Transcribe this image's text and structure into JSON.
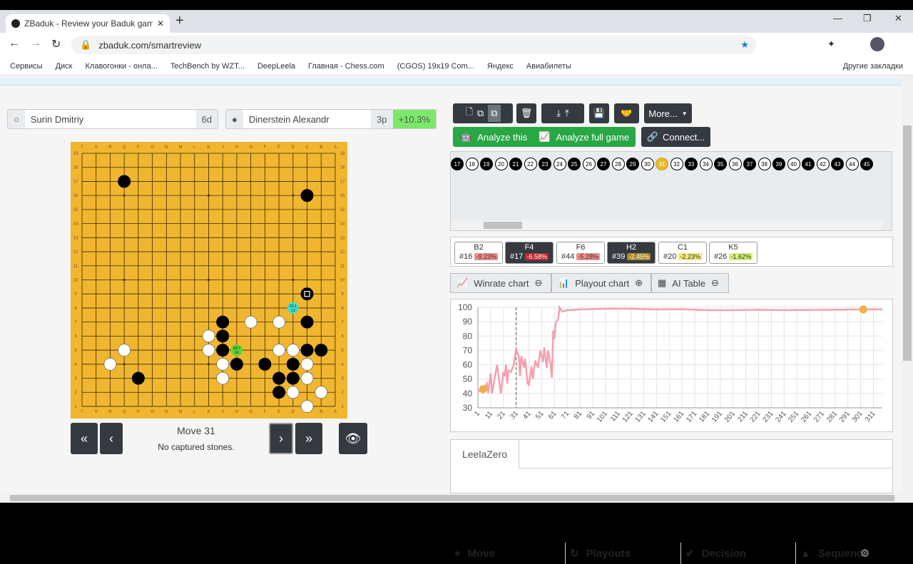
{
  "browser": {
    "tab_title": "ZBaduk - Review your Baduk gam",
    "new_tab": "+",
    "url": "zbaduk.com/smartreview",
    "bookmarks": [
      "Сервисы",
      "Диск",
      "Клавогонки - онла...",
      "TechBench by WZT...",
      "DeepLeela",
      "Главная - Chess.com",
      "(CGOS) 19x19 Com...",
      "Яндекс",
      "Авиабилеты"
    ],
    "other_bookmarks": "Другие закладки"
  },
  "players": {
    "white": {
      "name": "Surin Dmitriy",
      "rank": "6d"
    },
    "black": {
      "name": "Dinerstein Alexandr",
      "rank": "3p",
      "score": "+10.3%"
    }
  },
  "board": {
    "columns": [
      "T",
      "S",
      "R",
      "Q",
      "P",
      "O",
      "N",
      "M",
      "L",
      "K",
      "J",
      "H",
      "G",
      "F",
      "E",
      "D",
      "C",
      "B",
      "A"
    ],
    "black": [
      "Q17",
      "C16",
      "C9",
      "J7",
      "C7",
      "J6",
      "J5",
      "C5",
      "B5",
      "H4",
      "F4",
      "D4",
      "P3",
      "E3",
      "D3",
      "E2"
    ],
    "white": [
      "G7",
      "E7",
      "K6",
      "Q5",
      "K5",
      "E5",
      "D5",
      "R4",
      "J4",
      "C4",
      "J3",
      "C3",
      "D2",
      "B2",
      "C1"
    ],
    "last_move": "C9",
    "candidates": [
      {
        "point": "D8",
        "winrate": "29.1",
        "playouts": "13",
        "color": "#3ee0c8"
      },
      {
        "point": "H5",
        "winrate": "28.7",
        "playouts": "16",
        "color": "#5fd33a"
      }
    ]
  },
  "nav": {
    "move_label": "Move 31",
    "captures": "No captured stones.",
    "first": "«",
    "prev": "‹",
    "next": "›",
    "last": "»"
  },
  "toolbar": {
    "more": "More...",
    "analyze_this": "Analyze this",
    "analyze_full": "Analyze full game",
    "connect": "Connect..."
  },
  "moves": {
    "list": [
      [
        17,
        "b"
      ],
      [
        18,
        "w"
      ],
      [
        19,
        "b"
      ],
      [
        20,
        "w"
      ],
      [
        21,
        "b"
      ],
      [
        22,
        "w"
      ],
      [
        23,
        "b"
      ],
      [
        24,
        "w"
      ],
      [
        25,
        "b"
      ],
      [
        26,
        "w"
      ],
      [
        27,
        "b"
      ],
      [
        28,
        "w"
      ],
      [
        29,
        "b"
      ],
      [
        30,
        "w"
      ],
      [
        31,
        "cur"
      ],
      [
        32,
        "w"
      ],
      [
        33,
        "b"
      ],
      [
        34,
        "w"
      ],
      [
        35,
        "b"
      ],
      [
        36,
        "w"
      ],
      [
        37,
        "b"
      ],
      [
        38,
        "w"
      ],
      [
        39,
        "b"
      ],
      [
        40,
        "w"
      ],
      [
        41,
        "b"
      ],
      [
        42,
        "w"
      ],
      [
        43,
        "b"
      ],
      [
        44,
        "w"
      ],
      [
        45,
        "b"
      ]
    ]
  },
  "mistakes": [
    {
      "point": "B2",
      "move": "#16",
      "pct": "-9.23%",
      "color": "#f28b8b",
      "dark": false
    },
    {
      "point": "F4",
      "move": "#17",
      "pct": "-6.58%",
      "color": "#c0282e",
      "dark": true
    },
    {
      "point": "F6",
      "move": "#44",
      "pct": "-5.28%",
      "color": "#f28b8b",
      "dark": false
    },
    {
      "point": "H2",
      "move": "#39",
      "pct": "-2.45%",
      "color": "#a8882a",
      "dark": true
    },
    {
      "point": "C1",
      "move": "#20",
      "pct": "-2.23%",
      "color": "#f3ea7a",
      "dark": false
    },
    {
      "point": "K5",
      "move": "#26",
      "pct": "-1.62%",
      "color": "#d4f27a",
      "dark": false
    }
  ],
  "chart_tabs": [
    "Winrate chart",
    "Playout chart",
    "AI Table"
  ],
  "chart_data": {
    "type": "line",
    "ylim": [
      30,
      100
    ],
    "xlim": [
      1,
      318
    ],
    "yticks": [
      30,
      40,
      50,
      60,
      70,
      80,
      90,
      100
    ],
    "xticks": [
      1,
      11,
      21,
      31,
      41,
      51,
      61,
      71,
      81,
      91,
      101,
      111,
      121,
      131,
      141,
      151,
      161,
      171,
      181,
      191,
      201,
      211,
      221,
      231,
      241,
      251,
      261,
      271,
      281,
      291,
      301,
      311
    ],
    "current_move": 31,
    "line_color": "#f4a0b0",
    "marker_color": "#f0b040",
    "markers": [
      [
        5,
        43
      ],
      [
        303,
        98.5
      ]
    ],
    "series": [
      {
        "values": [
          [
            1,
            41
          ],
          [
            3,
            43
          ],
          [
            6,
            44
          ],
          [
            8,
            47
          ],
          [
            9,
            40
          ],
          [
            11,
            54
          ],
          [
            12,
            40
          ],
          [
            14,
            50
          ],
          [
            16,
            60
          ],
          [
            18,
            47
          ],
          [
            19,
            40
          ],
          [
            21,
            55
          ],
          [
            22,
            52
          ],
          [
            23,
            60
          ],
          [
            24,
            47
          ],
          [
            25,
            56
          ],
          [
            27,
            55
          ],
          [
            29,
            60
          ],
          [
            31,
            71
          ],
          [
            33,
            66
          ],
          [
            34,
            52
          ],
          [
            35,
            66
          ],
          [
            37,
            58
          ],
          [
            38,
            64
          ],
          [
            40,
            47
          ],
          [
            41,
            46
          ],
          [
            43,
            59
          ],
          [
            44,
            50
          ],
          [
            46,
            63
          ],
          [
            48,
            58
          ],
          [
            50,
            70
          ],
          [
            52,
            62
          ],
          [
            53,
            72
          ],
          [
            55,
            58
          ],
          [
            56,
            70
          ],
          [
            58,
            60
          ],
          [
            59,
            51
          ],
          [
            60,
            84
          ],
          [
            61,
            78
          ],
          [
            62,
            89
          ],
          [
            64,
            92
          ],
          [
            65,
            100
          ],
          [
            67,
            97
          ],
          [
            71,
            98
          ],
          [
            81,
            98.5
          ],
          [
            101,
            99
          ],
          [
            121,
            99
          ],
          [
            141,
            98.5
          ],
          [
            161,
            98.7
          ],
          [
            181,
            98
          ],
          [
            201,
            98
          ],
          [
            221,
            98.3
          ],
          [
            241,
            98
          ],
          [
            261,
            98.2
          ],
          [
            281,
            98.3
          ],
          [
            301,
            98.5
          ],
          [
            318,
            98.6
          ]
        ]
      }
    ]
  },
  "ai_table": {
    "engine_tab": "LeelaZero",
    "columns": [
      "Move",
      "Playouts",
      "Decision",
      "Sequence"
    ]
  }
}
